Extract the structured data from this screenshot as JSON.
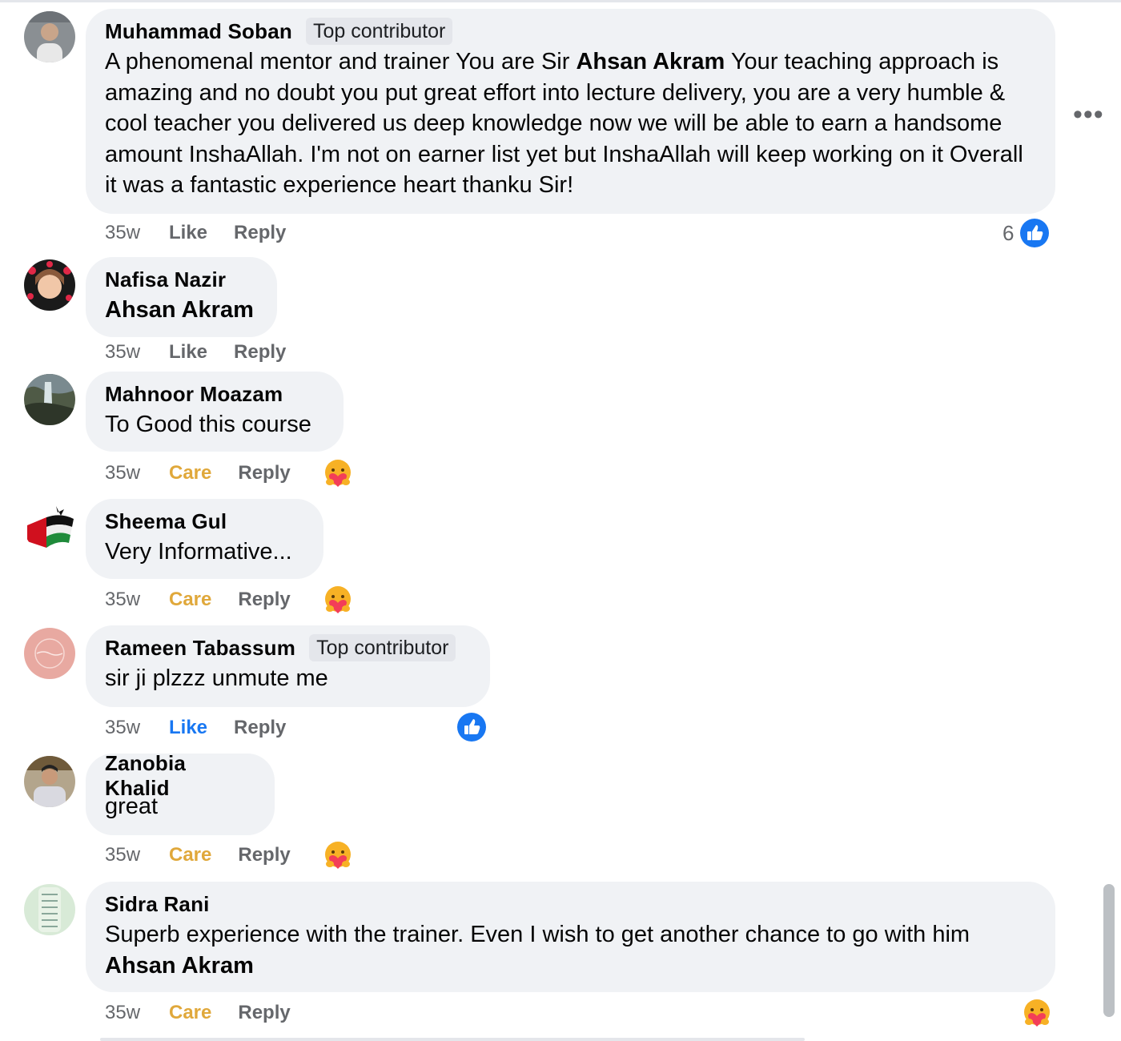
{
  "comments": [
    {
      "name": "Muhammad Soban",
      "badge": "Top contributor",
      "text_parts": [
        "A phenomenal mentor and trainer You are Sir ",
        "Ahsan Akram",
        " Your teaching approach is amazing and no doubt you put great effort into lecture delivery, you are a very humble & cool teacher you delivered us deep knowledge now we will be able to earn a handsome amount InshaAllah. I'm not on earner list yet but InshaAllah will keep working on it Overall it was a fantastic experience heart thanku Sir!"
      ],
      "time": "35w",
      "action": "Like",
      "reply": "Reply",
      "reaction_count": "6",
      "reaction_icon": "like-icon"
    },
    {
      "name": "Nafisa Nazir",
      "text": "Ahsan Akram",
      "time": "35w",
      "action": "Like",
      "reply": "Reply"
    },
    {
      "name": "Mahnoor Moazam",
      "text": "To Good this course",
      "time": "35w",
      "action": "Care",
      "reply": "Reply",
      "reaction_icon": "care-icon"
    },
    {
      "name": "Sheema Gul",
      "text": "Very Informative...",
      "time": "35w",
      "action": "Care",
      "reply": "Reply",
      "reaction_icon": "care-icon"
    },
    {
      "name": "Rameen Tabassum",
      "badge": "Top contributor",
      "text": "sir ji plzzz unmute me",
      "time": "35w",
      "action": "Like",
      "reply": "Reply",
      "reaction_icon": "like-icon"
    },
    {
      "name": "Zanobia Khalid",
      "text": "great",
      "time": "35w",
      "action": "Care",
      "reply": "Reply",
      "reaction_icon": "care-icon"
    },
    {
      "name": "Sidra Rani",
      "text_parts": [
        "Superb experience with the trainer. Even I wish to get another chance to go with him ",
        "Ahsan Akram"
      ],
      "time": "35w",
      "action": "Care",
      "reply": "Reply",
      "reaction_icon": "care-icon"
    }
  ],
  "more_menu": "•••",
  "colors": {
    "bubble": "#f0f2f5",
    "care": "#e0a83b",
    "like": "#1877f2",
    "meta": "#65676b"
  }
}
